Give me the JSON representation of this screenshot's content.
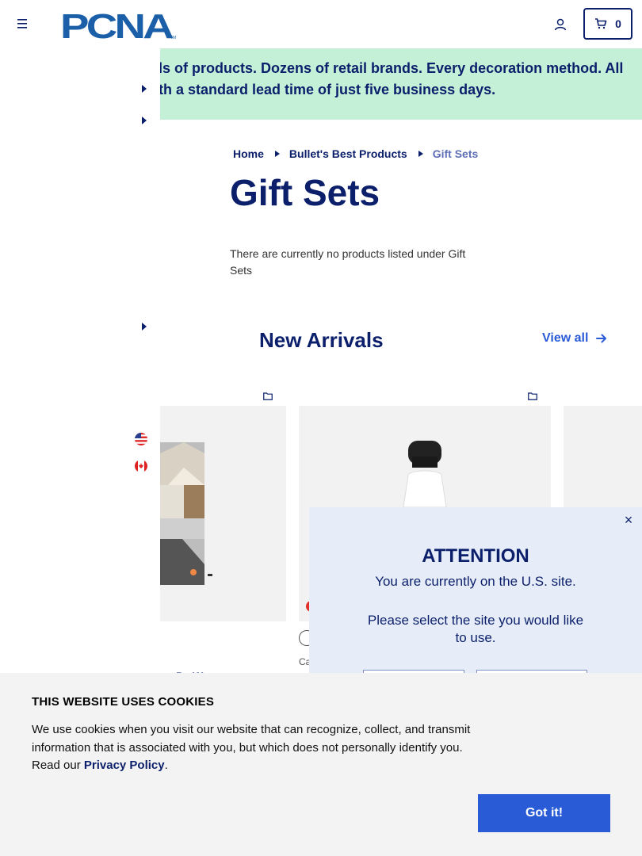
{
  "header": {
    "logo_text": "PCNA",
    "menu_icon": "hamburger-icon",
    "account_icon": "user-icon",
    "cart_icon": "cart-icon",
    "cart_count": "0"
  },
  "banner": {
    "line1": "ls of products. Dozens of retail brands. Every decoration method. All",
    "line2": "th a standard lead time of just five business days."
  },
  "breadcrumb": [
    {
      "label": "Home"
    },
    {
      "label": "Bullet's Best Products"
    },
    {
      "label": "Gift Sets"
    }
  ],
  "page": {
    "title": "Gift Sets",
    "empty_message": "There are currently no products listed under Gift Sets"
  },
  "new_arrivals": {
    "title": "New Arrivals",
    "view_all": "View all"
  },
  "cards": {
    "card2_category": "Ca",
    "card1_name": "Pa W"
  },
  "modal": {
    "title": "ATTENTION",
    "line1": "You are currently on the U.S. site.",
    "line2": "Please select the site you would like to use.",
    "close": "×"
  },
  "cookie": {
    "title": "THIS WEBSITE USES COOKIES",
    "body": "We use cookies when you visit our website that can recognize, collect, and transmit information that is associated with you, but which does not personally identify you. Read our ",
    "link": "Privacy Policy",
    "period": ".",
    "button": "Got it!"
  },
  "colors": {
    "brand": "#0b1f6b",
    "accent": "#2a5bd7",
    "banner_bg": "#c4f0d8",
    "modal_bg": "#e6edf8"
  }
}
